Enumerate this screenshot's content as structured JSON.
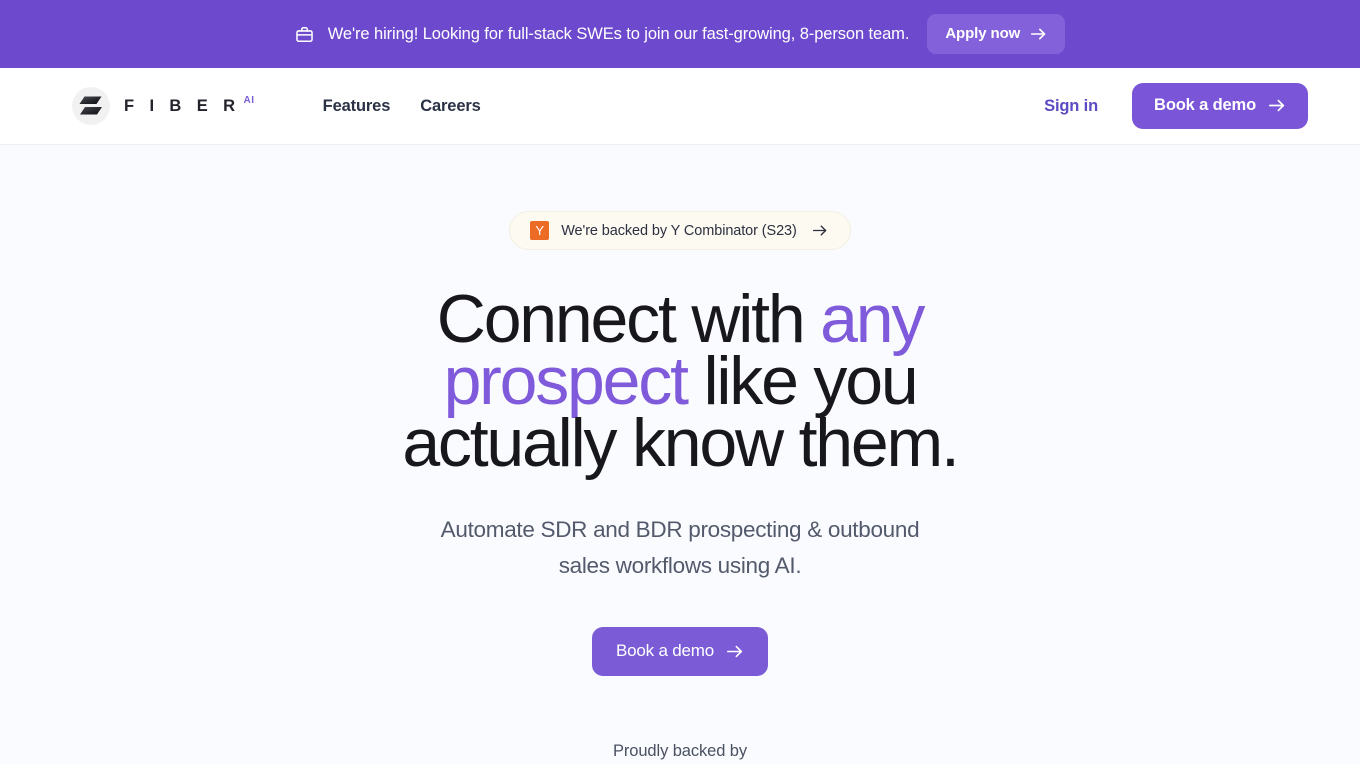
{
  "announcement": {
    "icon": "briefcase-icon",
    "message": "We're hiring! Looking for full-stack SWEs to join our fast-growing, 8-person team.",
    "cta_label": "Apply now",
    "cta_icon": "arrow-right-icon",
    "background_color": "#6D49CD",
    "cta_background_color": "#8361DA"
  },
  "header": {
    "brand": {
      "mark_icon": "fiber-logo-icon",
      "name": "F I B E R",
      "superscript": "AI",
      "superscript_color": "#7D5FD4"
    },
    "nav": [
      {
        "label": "Features"
      },
      {
        "label": "Careers"
      }
    ],
    "sign_in_label": "Sign in",
    "sign_in_color": "#5B4BC4",
    "demo_label": "Book a demo",
    "demo_icon": "arrow-right-icon",
    "demo_background_color": "#7B55D8"
  },
  "hero": {
    "badge": {
      "logo_letter": "Y",
      "logo_color": "#EC6C26",
      "text": "We're backed by Y Combinator (S23)",
      "icon": "arrow-right-icon",
      "background_color": "#FDFAF2"
    },
    "title": {
      "part1": "Connect with ",
      "accent1": "any prospect",
      "part2": " like you actually know them.",
      "accent_color": "#7F5ADA",
      "base_color": "#18181C"
    },
    "subtitle": "Automate SDR and BDR prospecting & outbound sales workflows using AI.",
    "cta_label": "Book a demo",
    "cta_icon": "arrow-right-icon",
    "cta_background_color": "#7B5CD6",
    "backed_by_label": "Proudly backed by"
  },
  "page": {
    "background_color": "#FAFBFF"
  }
}
